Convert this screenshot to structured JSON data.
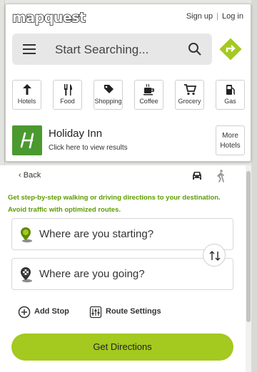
{
  "header": {
    "logo_text": "mapquest",
    "sign_up": "Sign up",
    "log_in": "Log in",
    "separator": "|"
  },
  "search": {
    "placeholder": "Start Searching..."
  },
  "categories": [
    {
      "label": "Hotels",
      "icon": "hotel-icon"
    },
    {
      "label": "Food",
      "icon": "food-icon"
    },
    {
      "label": "Shopping",
      "icon": "shopping-tag-icon"
    },
    {
      "label": "Coffee",
      "icon": "coffee-icon"
    },
    {
      "label": "Grocery",
      "icon": "grocery-cart-icon"
    },
    {
      "label": "Gas",
      "icon": "gas-pump-icon"
    }
  ],
  "ad": {
    "name": "Holiday Inn",
    "subtitle": "Click here to view results",
    "more_line1": "More",
    "more_line2": "Hotels"
  },
  "directions": {
    "back": "Back",
    "tagline_line1": "Get step-by-step walking or driving directions to your destination.",
    "tagline_line2": "Avoid traffic with optimized routes.",
    "start_placeholder": "Where are you starting?",
    "dest_placeholder": "Where are you going?",
    "add_stop": "Add Stop",
    "route_settings": "Route Settings",
    "submit": "Get Directions"
  },
  "colors": {
    "accent_green": "#a4c91f",
    "tagline_green": "#5e9b00",
    "holiday_inn_green": "#4b9a2f"
  }
}
